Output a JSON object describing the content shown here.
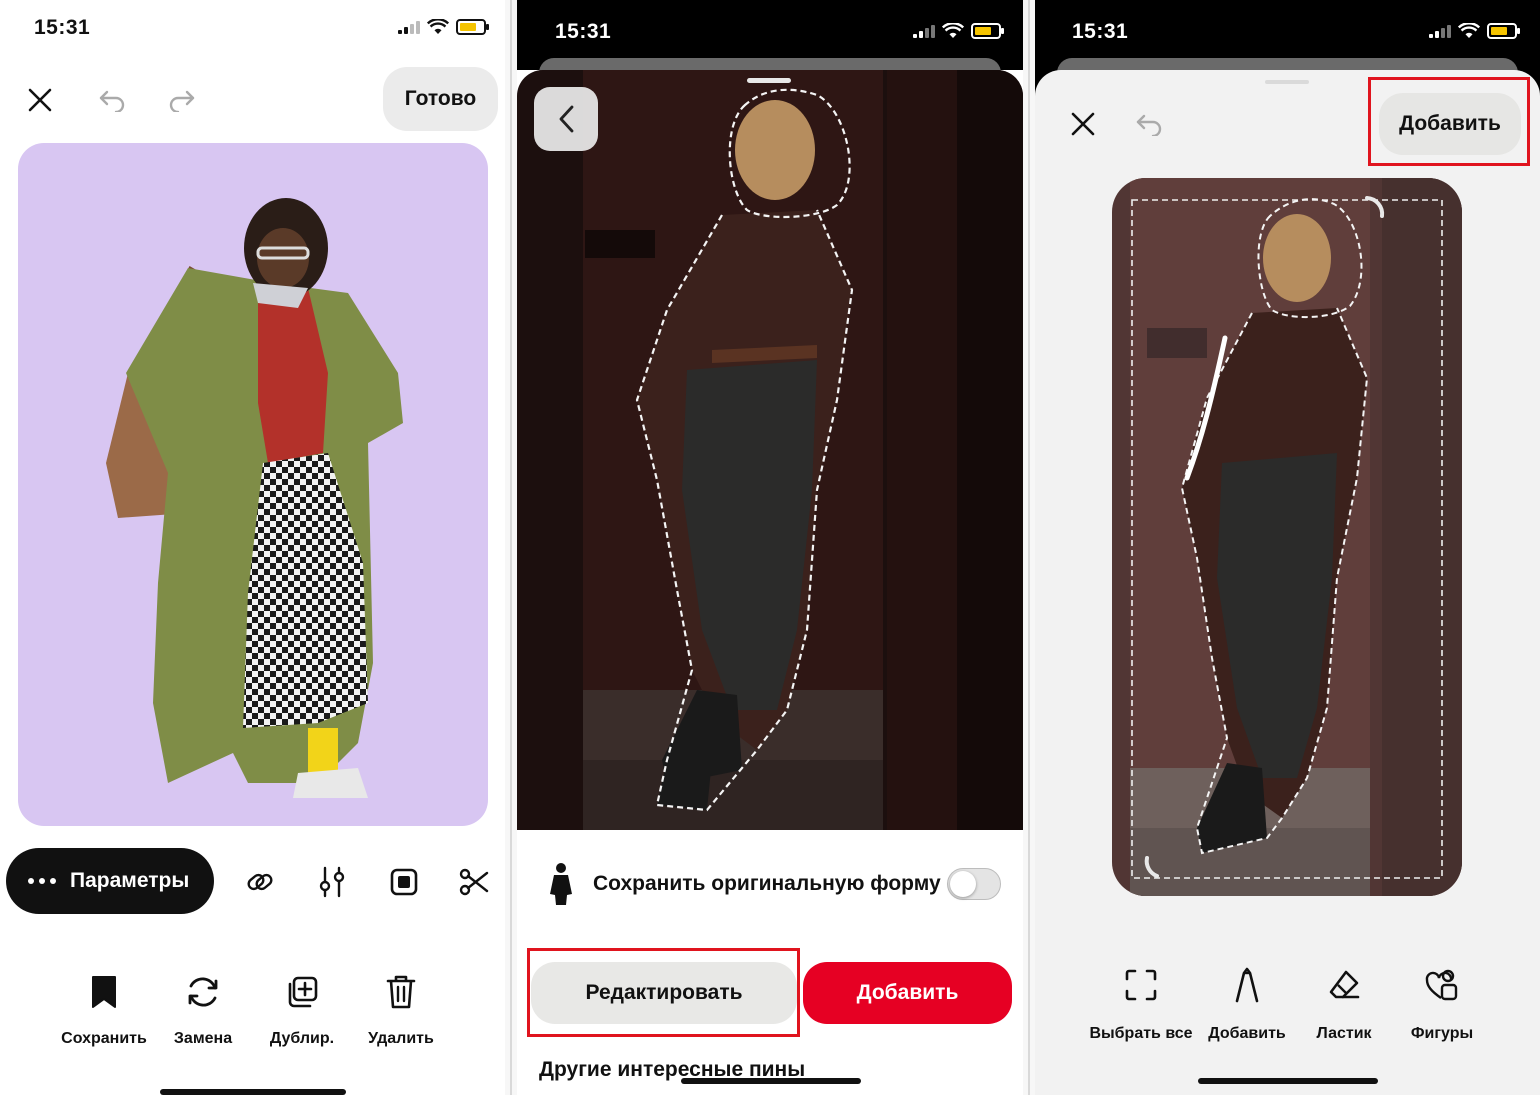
{
  "colors": {
    "accent_red": "#e60023",
    "highlight_box": "#e0141e",
    "card_lilac": "#d8c6f2",
    "pill_gray": "#ebebeb"
  },
  "panel1": {
    "status_time": "15:31",
    "done_label": "Готово",
    "params_label": "Параметры",
    "tool_icons": [
      "link-icon",
      "sliders-icon",
      "square-frame-icon",
      "scissors-icon"
    ],
    "actions": [
      {
        "label": "Сохранить",
        "icon": "bookmark-icon"
      },
      {
        "label": "Замена",
        "icon": "refresh-icon"
      },
      {
        "label": "Дублир.",
        "icon": "duplicate-icon"
      },
      {
        "label": "Удалить",
        "icon": "trash-icon"
      }
    ]
  },
  "panel2": {
    "status_time": "15:31",
    "keep_shape_label": "Сохранить оригинальную форму",
    "keep_shape_on": false,
    "edit_label": "Редактировать",
    "add_label": "Добавить",
    "more_pins_label": "Другие интересные пины"
  },
  "panel3": {
    "status_time": "15:31",
    "add_label": "Добавить",
    "tools": [
      {
        "label": "Выбрать все",
        "icon": "select-all-icon"
      },
      {
        "label": "Добавить",
        "icon": "pen-icon"
      },
      {
        "label": "Ластик",
        "icon": "eraser-icon"
      },
      {
        "label": "Фигуры",
        "icon": "shapes-icon"
      }
    ]
  }
}
